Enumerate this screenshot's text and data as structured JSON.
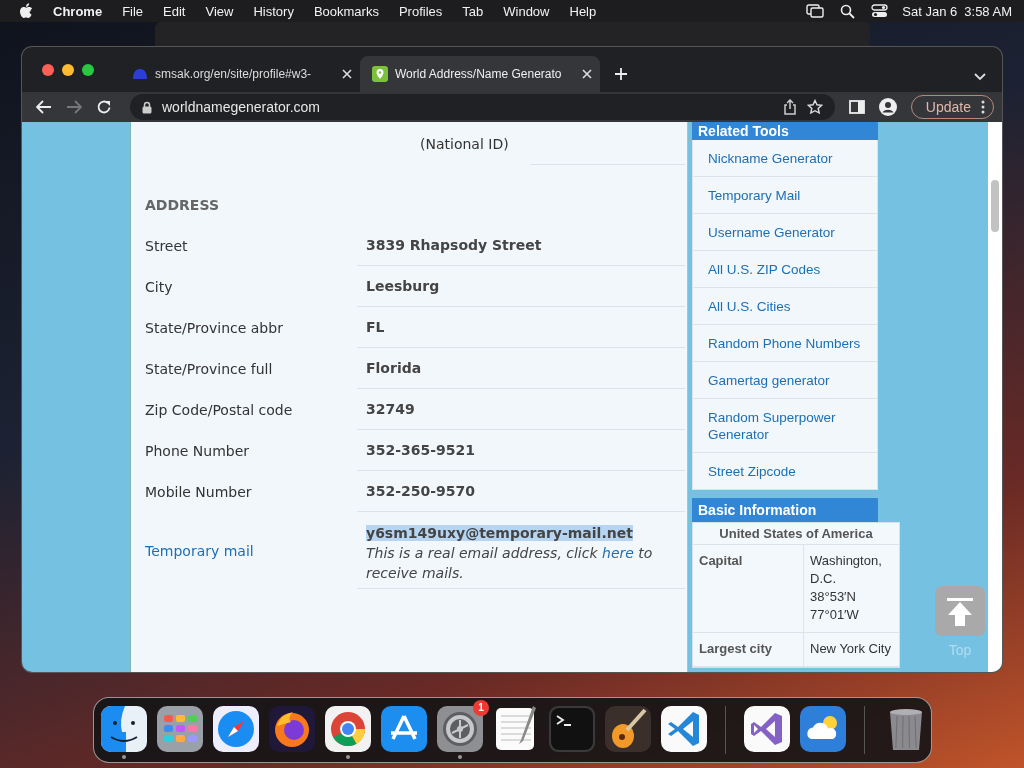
{
  "menu_bar": {
    "app": "Chrome",
    "menus": [
      "File",
      "Edit",
      "View",
      "History",
      "Bookmarks",
      "Profiles",
      "Tab",
      "Window",
      "Help"
    ],
    "date": "Sat Jan 6",
    "time": "3:58 AM"
  },
  "browser": {
    "tabs": [
      {
        "title": "smsak.org/en/site/profile#w3-",
        "selected": false
      },
      {
        "title": "World Address/Name Generato",
        "selected": true
      }
    ],
    "url": "worldnamegenerator.com",
    "update_button": "Update"
  },
  "page": {
    "top_row": {
      "label": "(National ID)"
    },
    "section": "ADDRESS",
    "rows": [
      {
        "label": "Street",
        "value": "3839 Rhapsody Street"
      },
      {
        "label": "City",
        "value": "Leesburg"
      },
      {
        "label": "State/Province abbr",
        "value": "FL"
      },
      {
        "label": "State/Province full",
        "value": "Florida"
      },
      {
        "label": "Zip Code/Postal code",
        "value": "32749"
      },
      {
        "label": "Phone Number",
        "value": "352-365-9521"
      },
      {
        "label": "Mobile Number",
        "value": "352-250-9570"
      }
    ],
    "temp_mail": {
      "label": "Temporary mail",
      "email": "y6sm149uxy@temporary-mail.net",
      "note_before": "This is a real email address, click",
      "note_link": "here",
      "note_after": "to receive mails."
    }
  },
  "sidebar": {
    "related_title": "Related Tools",
    "related": [
      "Nickname Generator",
      "Temporary Mail",
      "Username Generator",
      "All U.S. ZIP Codes",
      "All U.S. Cities",
      "Random Phone Numbers",
      "Gamertag generator",
      "Random Superpower Generator",
      "Street Zipcode"
    ],
    "basic_title": "Basic Information",
    "country": "United States of America",
    "facts": [
      {
        "label": "Capital",
        "lines": [
          "Washington, D.C.",
          "38°53′N",
          "77°01′W"
        ]
      },
      {
        "label": "Largest city",
        "lines": [
          "New York City"
        ]
      }
    ]
  },
  "scroll_top": {
    "label": "Top"
  },
  "dock": {
    "sections": [
      {
        "apps": [
          {
            "kind": "finder",
            "running": true
          },
          {
            "kind": "launchpad",
            "running": false
          },
          {
            "kind": "safari",
            "running": false
          },
          {
            "kind": "firefox",
            "running": false
          },
          {
            "kind": "chrome",
            "running": true
          },
          {
            "kind": "appstore",
            "running": false
          },
          {
            "kind": "settings",
            "running": true,
            "badge": "1"
          },
          {
            "kind": "textedit",
            "running": false
          },
          {
            "kind": "terminal",
            "running": false
          },
          {
            "kind": "garageband",
            "running": false
          },
          {
            "kind": "vscode",
            "running": false
          }
        ]
      },
      {
        "apps": [
          {
            "kind": "visualstudio",
            "running": false
          },
          {
            "kind": "weather",
            "running": false
          }
        ]
      },
      {
        "apps": [
          {
            "kind": "trash",
            "running": false
          }
        ]
      }
    ]
  }
}
